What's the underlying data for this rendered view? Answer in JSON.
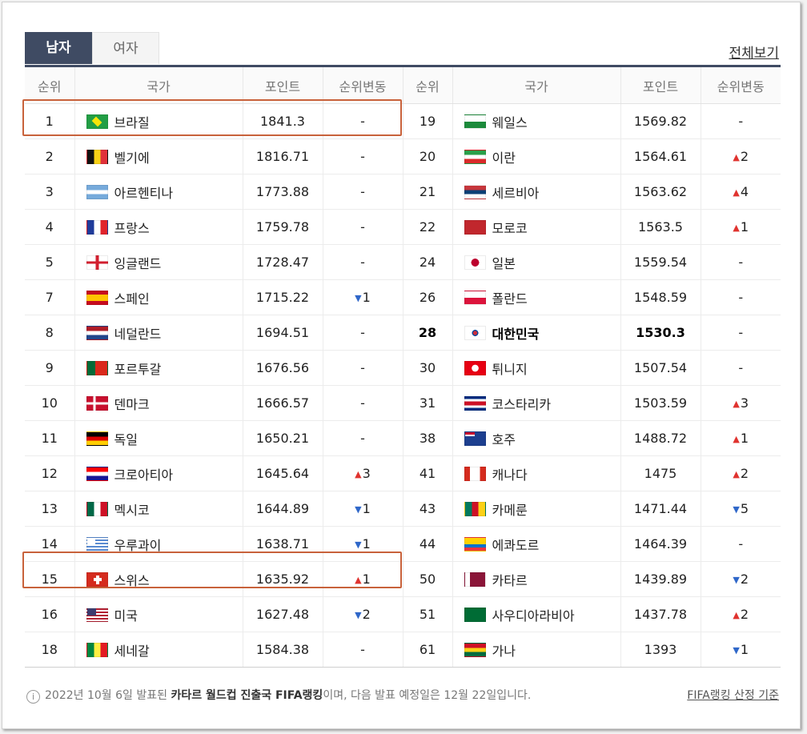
{
  "tabs": [
    {
      "label": "남자"
    },
    {
      "label": "여자"
    }
  ],
  "view_all": "전체보기",
  "headers": {
    "rank": "순위",
    "nation": "국가",
    "points": "포인트",
    "change": "순위변동"
  },
  "rows": [
    {
      "left": {
        "rank": "1",
        "name": "브라질",
        "points": "1841.3",
        "change": "-",
        "dir": "",
        "flag": "brazil"
      },
      "right": {
        "rank": "19",
        "name": "웨일스",
        "points": "1569.82",
        "change": "-",
        "dir": "",
        "flag": "wales"
      }
    },
    {
      "left": {
        "rank": "2",
        "name": "벨기에",
        "points": "1816.71",
        "change": "-",
        "dir": "",
        "flag": "belgium"
      },
      "right": {
        "rank": "20",
        "name": "이란",
        "points": "1564.61",
        "change": "2",
        "dir": "up",
        "flag": "iran"
      }
    },
    {
      "left": {
        "rank": "3",
        "name": "아르헨티나",
        "points": "1773.88",
        "change": "-",
        "dir": "",
        "flag": "argentina"
      },
      "right": {
        "rank": "21",
        "name": "세르비아",
        "points": "1563.62",
        "change": "4",
        "dir": "up",
        "flag": "serbia"
      }
    },
    {
      "left": {
        "rank": "4",
        "name": "프랑스",
        "points": "1759.78",
        "change": "-",
        "dir": "",
        "flag": "france"
      },
      "right": {
        "rank": "22",
        "name": "모로코",
        "points": "1563.5",
        "change": "1",
        "dir": "up",
        "flag": "morocco"
      }
    },
    {
      "left": {
        "rank": "5",
        "name": "잉글랜드",
        "points": "1728.47",
        "change": "-",
        "dir": "",
        "flag": "england"
      },
      "right": {
        "rank": "24",
        "name": "일본",
        "points": "1559.54",
        "change": "-",
        "dir": "",
        "flag": "japan"
      }
    },
    {
      "left": {
        "rank": "7",
        "name": "스페인",
        "points": "1715.22",
        "change": "1",
        "dir": "down",
        "flag": "spain"
      },
      "right": {
        "rank": "26",
        "name": "폴란드",
        "points": "1548.59",
        "change": "-",
        "dir": "",
        "flag": "poland"
      }
    },
    {
      "left": {
        "rank": "8",
        "name": "네덜란드",
        "points": "1694.51",
        "change": "-",
        "dir": "",
        "flag": "netherlands"
      },
      "right": {
        "rank": "28",
        "name": "대한민국",
        "points": "1530.3",
        "change": "-",
        "dir": "",
        "flag": "korea",
        "bold": true
      }
    },
    {
      "left": {
        "rank": "9",
        "name": "포르투갈",
        "points": "1676.56",
        "change": "-",
        "dir": "",
        "flag": "portugal"
      },
      "right": {
        "rank": "30",
        "name": "튀니지",
        "points": "1507.54",
        "change": "-",
        "dir": "",
        "flag": "tunisia"
      }
    },
    {
      "left": {
        "rank": "10",
        "name": "덴마크",
        "points": "1666.57",
        "change": "-",
        "dir": "",
        "flag": "denmark"
      },
      "right": {
        "rank": "31",
        "name": "코스타리카",
        "points": "1503.59",
        "change": "3",
        "dir": "up",
        "flag": "costarica"
      }
    },
    {
      "left": {
        "rank": "11",
        "name": "독일",
        "points": "1650.21",
        "change": "-",
        "dir": "",
        "flag": "germany"
      },
      "right": {
        "rank": "38",
        "name": "호주",
        "points": "1488.72",
        "change": "1",
        "dir": "up",
        "flag": "australia"
      }
    },
    {
      "left": {
        "rank": "12",
        "name": "크로아티아",
        "points": "1645.64",
        "change": "3",
        "dir": "up",
        "flag": "croatia"
      },
      "right": {
        "rank": "41",
        "name": "캐나다",
        "points": "1475",
        "change": "2",
        "dir": "up",
        "flag": "canada"
      }
    },
    {
      "left": {
        "rank": "13",
        "name": "멕시코",
        "points": "1644.89",
        "change": "1",
        "dir": "down",
        "flag": "mexico"
      },
      "right": {
        "rank": "43",
        "name": "카메룬",
        "points": "1471.44",
        "change": "5",
        "dir": "down",
        "flag": "cameroon"
      }
    },
    {
      "left": {
        "rank": "14",
        "name": "우루과이",
        "points": "1638.71",
        "change": "1",
        "dir": "down",
        "flag": "uruguay"
      },
      "right": {
        "rank": "44",
        "name": "에콰도르",
        "points": "1464.39",
        "change": "-",
        "dir": "",
        "flag": "ecuador"
      }
    },
    {
      "left": {
        "rank": "15",
        "name": "스위스",
        "points": "1635.92",
        "change": "1",
        "dir": "up",
        "flag": "switzerland"
      },
      "right": {
        "rank": "50",
        "name": "카타르",
        "points": "1439.89",
        "change": "2",
        "dir": "down",
        "flag": "qatar"
      }
    },
    {
      "left": {
        "rank": "16",
        "name": "미국",
        "points": "1627.48",
        "change": "2",
        "dir": "down",
        "flag": "usa"
      },
      "right": {
        "rank": "51",
        "name": "사우디아라비아",
        "points": "1437.78",
        "change": "2",
        "dir": "up",
        "flag": "saudi"
      }
    },
    {
      "left": {
        "rank": "18",
        "name": "세네갈",
        "points": "1584.38",
        "change": "-",
        "dir": "",
        "flag": "senegal"
      },
      "right": {
        "rank": "61",
        "name": "가나",
        "points": "1393",
        "change": "1",
        "dir": "down",
        "flag": "ghana"
      }
    }
  ],
  "footer": {
    "prefix": "2022년 10월 6일 발표된 ",
    "bold": "카타르 월드컵 진출국 FIFA랭킹",
    "suffix": "이며, 다음 발표 예정일은 12월 22일입니다.",
    "link": "FIFA랭킹 산정 기준"
  },
  "colors": {
    "tab_active": "#3f4b63",
    "highlight": "#c8623b",
    "arrow_up": "#e0332f",
    "arrow_down": "#2f67c9"
  }
}
